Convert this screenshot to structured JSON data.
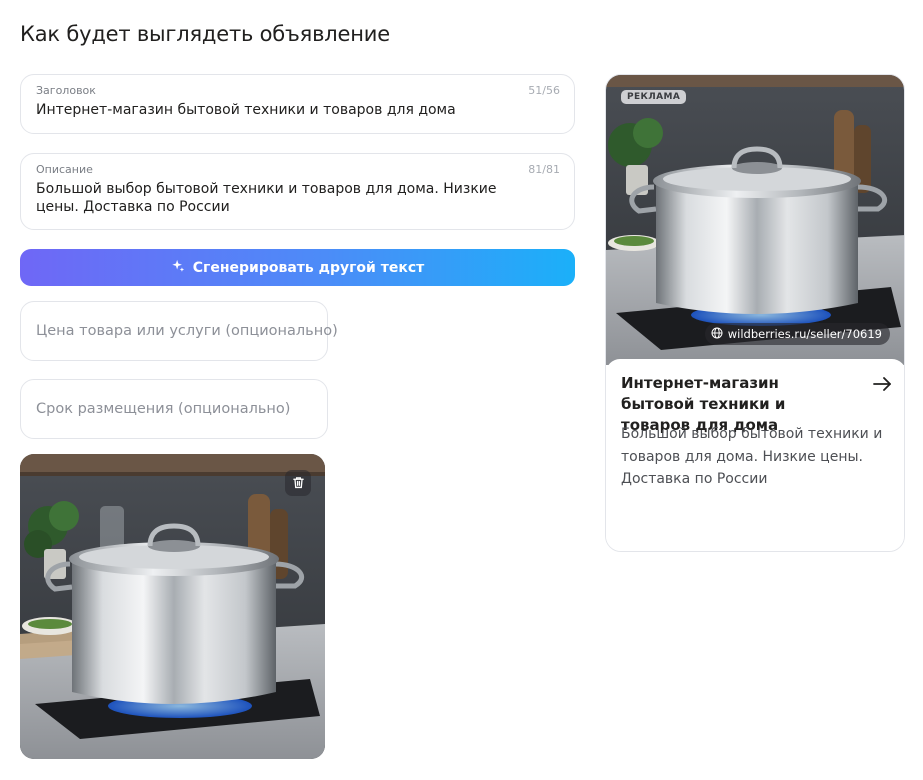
{
  "page": {
    "title": "Как будет выглядеть объявление"
  },
  "form": {
    "headline": {
      "label": "Заголовок",
      "counter": "51/56",
      "value": "Интернет-магазин бытовой техники и товаров для дома"
    },
    "description": {
      "label": "Описание",
      "counter": "81/81",
      "value": "Большой выбор бытовой техники и товаров для дома. Низкие цены. Доставка по России"
    },
    "generate_button": {
      "label": "Сгенерировать другой текст",
      "icon": "sparkles-icon"
    },
    "price": {
      "placeholder": "Цена товара или услуги (опционально)"
    },
    "period": {
      "placeholder": "Срок размещения (опционально)"
    },
    "image": {
      "delete_icon": "trash-icon"
    }
  },
  "preview": {
    "badge": "РЕКЛАМА",
    "domain": "wildberries.ru/seller/70619",
    "title": "Интернет-магазин бытовой техники и товаров для дома",
    "description": "Большой выбор бытовой техники и товаров для дома. Низкие цены. Доставка по России",
    "arrow_icon": "arrow-right-icon",
    "globe_icon": "globe-icon"
  },
  "colors": {
    "gradient_start": "#6f67f6",
    "gradient_end": "#1bb0f9",
    "border": "#e3e5ea"
  }
}
